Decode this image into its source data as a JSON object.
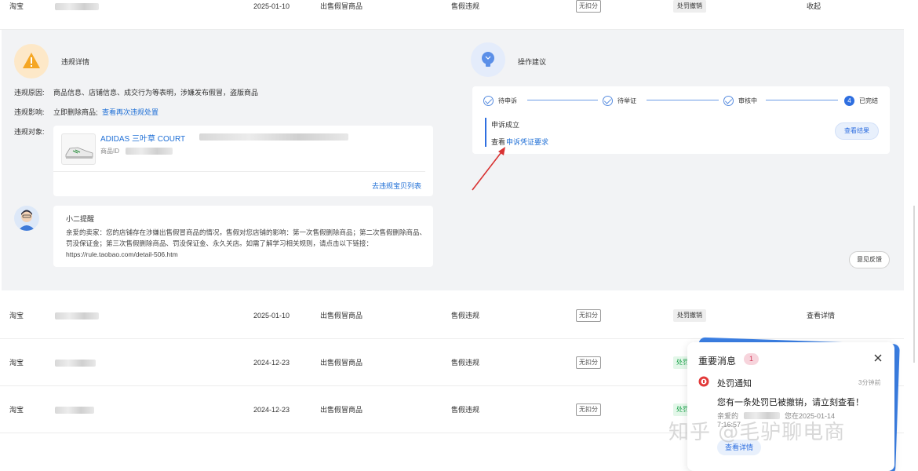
{
  "rows": [
    {
      "platform": "淘宝",
      "date": "2025-01-10",
      "type": "出售假冒商品",
      "category": "售假违规",
      "deduct": "无扣分",
      "status": "处罚撤销",
      "action": "收起"
    },
    {
      "platform": "淘宝",
      "date": "2025-01-10",
      "type": "出售假冒商品",
      "category": "售假违规",
      "deduct": "无扣分",
      "status": "处罚撤销",
      "action": "查看详情"
    },
    {
      "platform": "淘宝",
      "date": "2024-12-23",
      "type": "出售假冒商品",
      "category": "售假违规",
      "deduct": "无扣分",
      "status": "处罚"
    },
    {
      "platform": "淘宝",
      "date": "2024-12-23",
      "type": "出售假冒商品",
      "category": "售假违规",
      "deduct": "无扣分",
      "status": "处罚"
    }
  ],
  "violation": {
    "title": "违规详情",
    "reason_label": "违规原因:",
    "reason_text": "商品信息、店铺信息、成交行为等表明，涉嫌发布假冒，盗版商品",
    "impact_label": "违规影响:",
    "impact_text": "立即删除商品;",
    "impact_link": "查看再次违规处置",
    "object_label": "违规对象:",
    "product_title": "ADIDAS 三叶草 COURT",
    "product_id_label": "商品ID",
    "product_list_link": "去违规宝贝列表"
  },
  "reminder": {
    "title": "小二提醒",
    "body": "亲爱的卖家：您的店铺存在涉嫌出售假冒商品的情况，售假对您店铺的影响：第一次售假删除商品；第二次售假删除商品、罚没保证金；第三次售假删除商品、罚没保证金、永久关店。如需了解学习相关规则，请点击以下链接：https://rule.taobao.com/detail-506.htm"
  },
  "suggestion": {
    "title": "操作建议",
    "steps": [
      "待申诉",
      "待举证",
      "审核中",
      "已完结"
    ],
    "step_number": "4",
    "result_title": "申诉成立",
    "result_prefix": "查看",
    "result_link": "申诉凭证要求",
    "result_button": "查看结果",
    "feedback_button": "意见反馈"
  },
  "notification": {
    "title": "重要消息",
    "count": "1",
    "item_title": "处罚通知",
    "time": "3分钟前",
    "message": "您有一条处罚已被撤销，请立刻查看！",
    "detail_line1_a": "亲爱的",
    "detail_line1_b": "您在2025-01-14",
    "detail_line2": "7:16:57",
    "button": "查看详情"
  },
  "watermark": "知乎 @毛驴聊电商",
  "colors": {
    "accent": "#1f6fd6",
    "warning": "#f5a623",
    "badge": "#f7d4dc",
    "danger": "#e23a3a"
  }
}
